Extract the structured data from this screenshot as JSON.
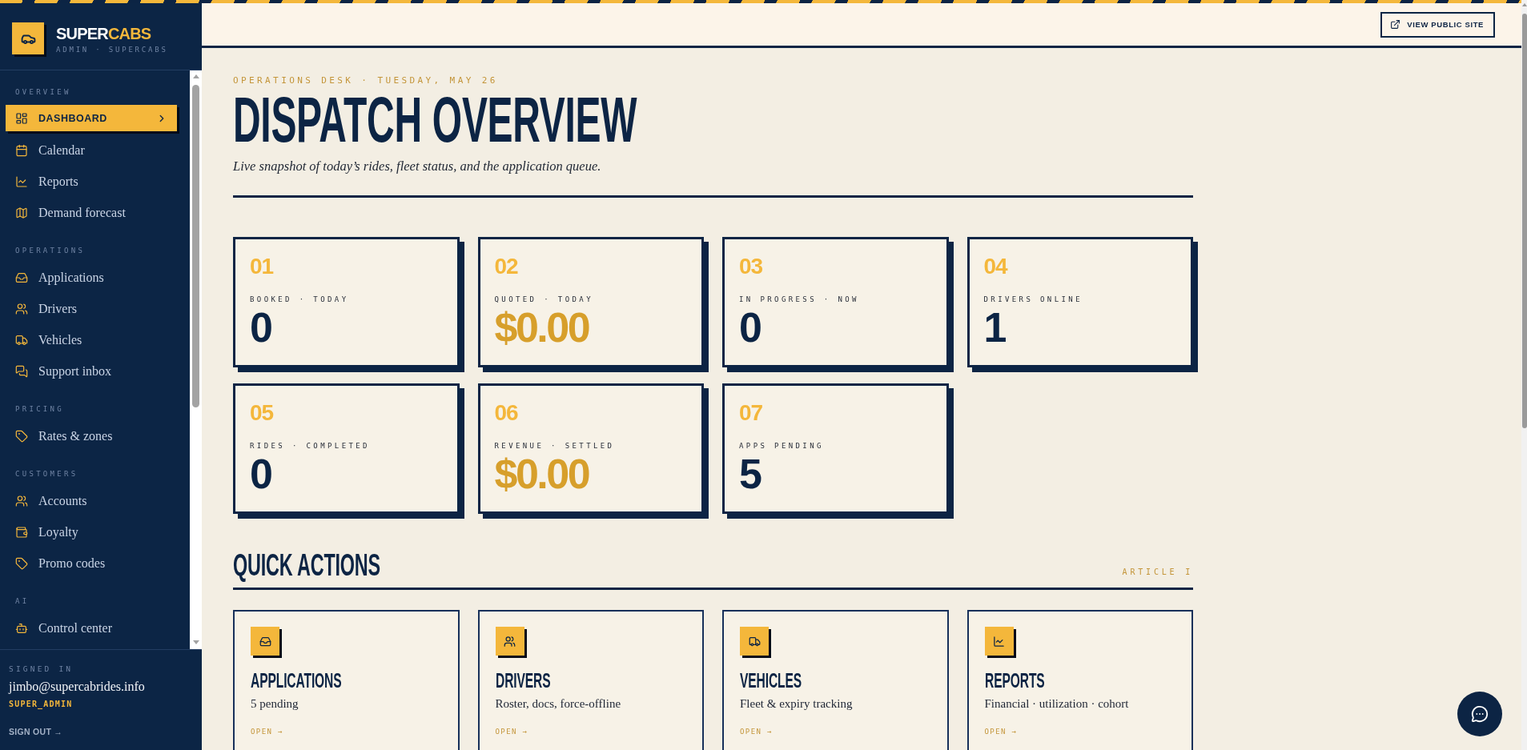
{
  "brand": {
    "name_start": "SUPER",
    "name_accent": "CABS",
    "subtitle": "ADMIN · SUPERCABS"
  },
  "sidebar": {
    "sections": [
      {
        "label": "OVERVIEW",
        "items": [
          {
            "label": "DASHBOARD",
            "selected": true
          },
          {
            "label": "Calendar",
            "selected": false
          },
          {
            "label": "Reports",
            "selected": false
          },
          {
            "label": "Demand forecast",
            "selected": false
          }
        ]
      },
      {
        "label": "OPERATIONS",
        "items": [
          {
            "label": "Applications",
            "selected": false
          },
          {
            "label": "Drivers",
            "selected": false
          },
          {
            "label": "Vehicles",
            "selected": false
          },
          {
            "label": "Support inbox",
            "selected": false
          }
        ]
      },
      {
        "label": "PRICING",
        "items": [
          {
            "label": "Rates & zones",
            "selected": false
          }
        ]
      },
      {
        "label": "CUSTOMERS",
        "items": [
          {
            "label": "Accounts",
            "selected": false
          },
          {
            "label": "Loyalty",
            "selected": false
          },
          {
            "label": "Promo codes",
            "selected": false
          }
        ]
      },
      {
        "label": "AI",
        "items": [
          {
            "label": "Control center",
            "selected": false
          }
        ]
      }
    ],
    "footer": {
      "label": "SIGNED IN",
      "email": "jimbo@supercabrides.info",
      "role": "SUPER_ADMIN",
      "sign_out": "SIGN OUT →"
    }
  },
  "top_bar": {
    "button": "VIEW PUBLIC SITE"
  },
  "header": {
    "eyebrow": "OPERATIONS DESK · TUESDAY, MAY 26",
    "title": "DISPATCH OVERVIEW",
    "subtitle": "Live snapshot of today’s rides, fleet status, and the application queue."
  },
  "stats": [
    {
      "number": "01",
      "label": "BOOKED · TODAY",
      "value": "0",
      "kind": "count"
    },
    {
      "number": "02",
      "label": "QUOTED · TODAY",
      "value": "$0.00",
      "kind": "currency"
    },
    {
      "number": "03",
      "label": "IN PROGRESS · NOW",
      "value": "0",
      "kind": "count"
    },
    {
      "number": "04",
      "label": "DRIVERS ONLINE",
      "value": "1",
      "kind": "count"
    },
    {
      "number": "05",
      "label": "RIDES · COMPLETED",
      "value": "0",
      "kind": "count"
    },
    {
      "number": "06",
      "label": "REVENUE · SETTLED",
      "value": "$0.00",
      "kind": "currency"
    },
    {
      "number": "07",
      "label": "APPS PENDING",
      "value": "5",
      "kind": "count"
    }
  ],
  "quick_actions": {
    "title": "QUICK ACTIONS",
    "tag": "ARTICLE I",
    "cards": [
      {
        "title": "APPLICATIONS",
        "description": "5 pending",
        "link": "OPEN →"
      },
      {
        "title": "DRIVERS",
        "description": "Roster, docs, force-offline",
        "link": "OPEN →"
      },
      {
        "title": "VEHICLES",
        "description": "Fleet & expiry tracking",
        "link": "OPEN →"
      },
      {
        "title": "REPORTS",
        "description": "Financial · utilization · cohort",
        "link": "OPEN →"
      }
    ]
  }
}
